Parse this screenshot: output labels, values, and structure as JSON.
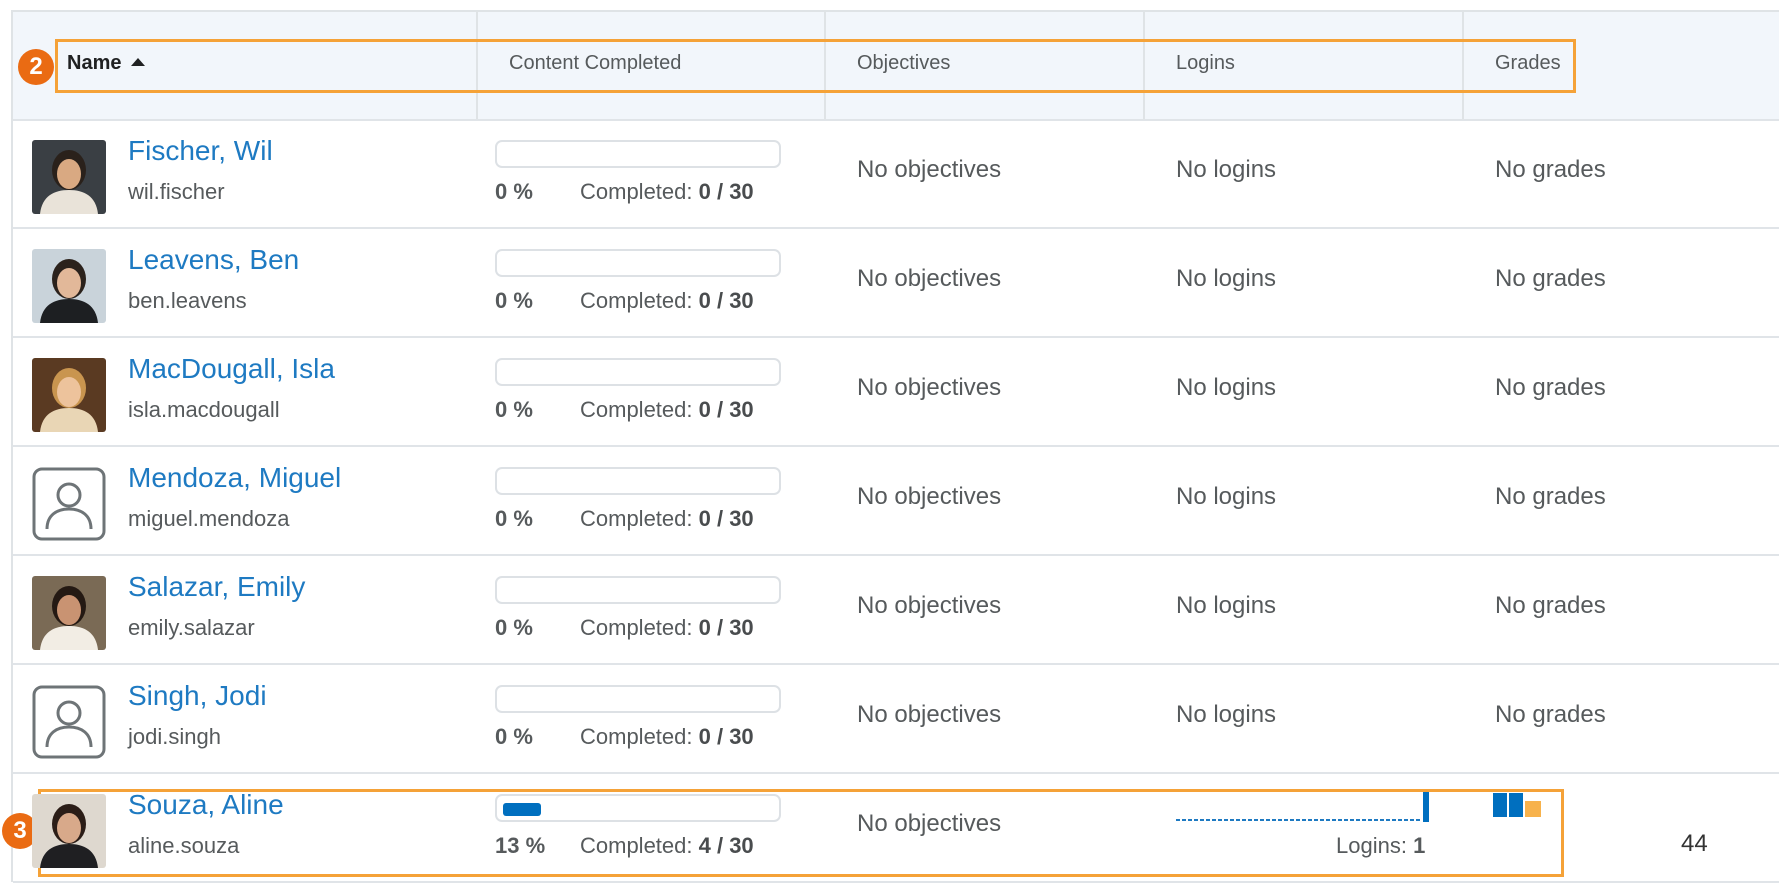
{
  "header": {
    "name_label": "Name",
    "content_label": "Content Completed",
    "objectives_label": "Objectives",
    "logins_label": "Logins",
    "grades_label": "Grades"
  },
  "callouts": {
    "header_badge": "2",
    "row_badge": "3"
  },
  "rows": [
    {
      "name": "Fischer, Wil",
      "username": "wil.fischer",
      "percent": "0 %",
      "completed_label": "Completed:",
      "completed_value": "0 / 30",
      "progress": 0,
      "objectives": "No objectives",
      "logins": "No logins",
      "grades": "No grades",
      "avatar": "photo-man-dark-hair"
    },
    {
      "name": "Leavens, Ben",
      "username": "ben.leavens",
      "percent": "0 %",
      "completed_label": "Completed:",
      "completed_value": "0 / 30",
      "progress": 0,
      "objectives": "No objectives",
      "logins": "No logins",
      "grades": "No grades",
      "avatar": "photo-man-jacket"
    },
    {
      "name": "MacDougall, Isla",
      "username": "isla.macdougall",
      "percent": "0 %",
      "completed_label": "Completed:",
      "completed_value": "0 / 30",
      "progress": 0,
      "objectives": "No objectives",
      "logins": "No logins",
      "grades": "No grades",
      "avatar": "photo-woman-blonde"
    },
    {
      "name": "Mendoza, Miguel",
      "username": "miguel.mendoza",
      "percent": "0 %",
      "completed_label": "Completed:",
      "completed_value": "0 / 30",
      "progress": 0,
      "objectives": "No objectives",
      "logins": "No logins",
      "grades": "No grades",
      "avatar": "default-user-icon"
    },
    {
      "name": "Salazar, Emily",
      "username": "emily.salazar",
      "percent": "0 %",
      "completed_label": "Completed:",
      "completed_value": "0 / 30",
      "progress": 0,
      "objectives": "No objectives",
      "logins": "No logins",
      "grades": "No grades",
      "avatar": "photo-woman-dark-hair"
    },
    {
      "name": "Singh, Jodi",
      "username": "jodi.singh",
      "percent": "0 %",
      "completed_label": "Completed:",
      "completed_value": "0 / 30",
      "progress": 0,
      "objectives": "No objectives",
      "logins": "No logins",
      "grades": "No grades",
      "avatar": "default-user-icon"
    },
    {
      "name": "Souza, Aline",
      "username": "aline.souza",
      "percent": "13 %",
      "completed_label": "Completed:",
      "completed_value": "4 / 30",
      "progress": 0.13,
      "objectives": "No objectives",
      "logins_label": "Logins:",
      "logins_value": "1",
      "grades": "",
      "avatar": "photo-woman-smiling"
    }
  ],
  "page_number": "44",
  "colors": {
    "link": "#1e7ac2",
    "progress": "#006fbf",
    "highlight": "#f5a238",
    "badge": "#ea6b13",
    "grade_alt": "#f7b24c"
  }
}
